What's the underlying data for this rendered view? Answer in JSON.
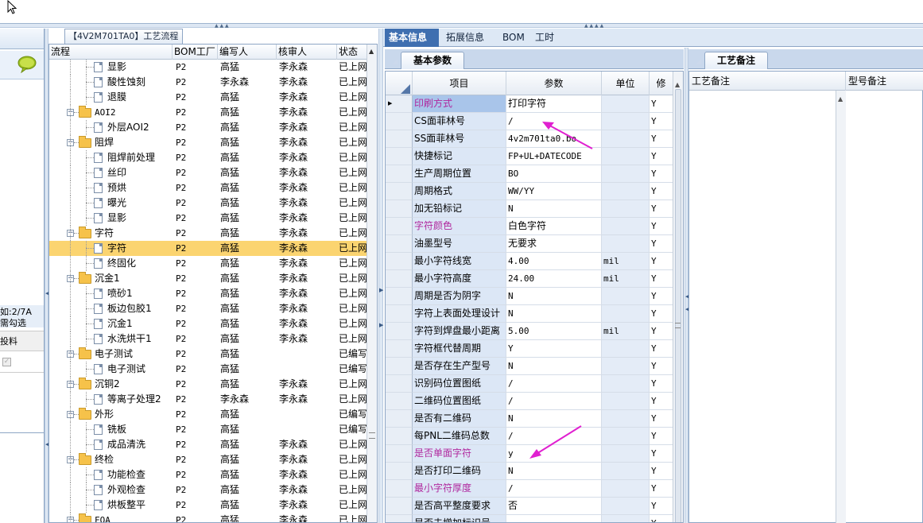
{
  "window": {
    "title": "【4V2M701TA0】工艺流程"
  },
  "left_panel": {
    "text1": "如:2/7A",
    "text2": "需勾选",
    "text3": "投料"
  },
  "tree": {
    "columns": [
      "流程",
      "BOM工厂",
      "编写人",
      "核审人",
      "状态"
    ],
    "rows": [
      {
        "level": 2,
        "kind": "doc",
        "name": "显影",
        "bom": "P2",
        "writer": "高猛",
        "checker": "李永森",
        "status": "已上网"
      },
      {
        "level": 2,
        "kind": "doc",
        "name": "酸性蚀刻",
        "bom": "P2",
        "writer": "李永森",
        "checker": "李永森",
        "status": "已上网"
      },
      {
        "level": 2,
        "kind": "doc",
        "name": "退膜",
        "bom": "P2",
        "writer": "高猛",
        "checker": "李永森",
        "status": "已上网"
      },
      {
        "level": 1,
        "kind": "folder",
        "name": "AOI2",
        "bom": "P2",
        "writer": "高猛",
        "checker": "李永森",
        "status": "已上网"
      },
      {
        "level": 2,
        "kind": "doc",
        "name": "外层AOI2",
        "bom": "P2",
        "writer": "高猛",
        "checker": "李永森",
        "status": "已上网"
      },
      {
        "level": 1,
        "kind": "folder",
        "name": "阻焊",
        "bom": "P2",
        "writer": "高猛",
        "checker": "李永森",
        "status": "已上网"
      },
      {
        "level": 2,
        "kind": "doc",
        "name": "阻焊前处理",
        "bom": "P2",
        "writer": "高猛",
        "checker": "李永森",
        "status": "已上网"
      },
      {
        "level": 2,
        "kind": "doc",
        "name": "丝印",
        "bom": "P2",
        "writer": "高猛",
        "checker": "李永森",
        "status": "已上网"
      },
      {
        "level": 2,
        "kind": "doc",
        "name": "预烘",
        "bom": "P2",
        "writer": "高猛",
        "checker": "李永森",
        "status": "已上网"
      },
      {
        "level": 2,
        "kind": "doc",
        "name": "曝光",
        "bom": "P2",
        "writer": "高猛",
        "checker": "李永森",
        "status": "已上网"
      },
      {
        "level": 2,
        "kind": "doc",
        "name": "显影",
        "bom": "P2",
        "writer": "高猛",
        "checker": "李永森",
        "status": "已上网"
      },
      {
        "level": 1,
        "kind": "folder",
        "name": "字符",
        "bom": "P2",
        "writer": "高猛",
        "checker": "李永森",
        "status": "已上网"
      },
      {
        "level": 2,
        "kind": "doc",
        "name": "字符",
        "bom": "P2",
        "writer": "高猛",
        "checker": "李永森",
        "status": "已上网",
        "selected": true
      },
      {
        "level": 2,
        "kind": "doc",
        "name": "终固化",
        "bom": "P2",
        "writer": "高猛",
        "checker": "李永森",
        "status": "已上网"
      },
      {
        "level": 1,
        "kind": "folder",
        "name": "沉金1",
        "bom": "P2",
        "writer": "高猛",
        "checker": "李永森",
        "status": "已上网"
      },
      {
        "level": 2,
        "kind": "doc",
        "name": "喷砂1",
        "bom": "P2",
        "writer": "高猛",
        "checker": "李永森",
        "status": "已上网"
      },
      {
        "level": 2,
        "kind": "doc",
        "name": "板边包胶1",
        "bom": "P2",
        "writer": "高猛",
        "checker": "李永森",
        "status": "已上网"
      },
      {
        "level": 2,
        "kind": "doc",
        "name": "沉金1",
        "bom": "P2",
        "writer": "高猛",
        "checker": "李永森",
        "status": "已上网"
      },
      {
        "level": 2,
        "kind": "doc",
        "name": "水洗烘干1",
        "bom": "P2",
        "writer": "高猛",
        "checker": "李永森",
        "status": "已上网"
      },
      {
        "level": 1,
        "kind": "folder",
        "name": "电子测试",
        "bom": "P2",
        "writer": "高猛",
        "checker": "",
        "status": "已编写"
      },
      {
        "level": 2,
        "kind": "doc",
        "name": "电子测试",
        "bom": "P2",
        "writer": "高猛",
        "checker": "",
        "status": "已编写"
      },
      {
        "level": 1,
        "kind": "folder",
        "name": "沉铜2",
        "bom": "P2",
        "writer": "高猛",
        "checker": "李永森",
        "status": "已上网"
      },
      {
        "level": 2,
        "kind": "doc",
        "name": "等离子处理2",
        "bom": "P2",
        "writer": "李永森",
        "checker": "李永森",
        "status": "已上网"
      },
      {
        "level": 1,
        "kind": "folder",
        "name": "外形",
        "bom": "P2",
        "writer": "高猛",
        "checker": "",
        "status": "已编写"
      },
      {
        "level": 2,
        "kind": "doc",
        "name": "铣板",
        "bom": "P2",
        "writer": "高猛",
        "checker": "",
        "status": "已编写"
      },
      {
        "level": 2,
        "kind": "doc",
        "name": "成品清洗",
        "bom": "P2",
        "writer": "高猛",
        "checker": "李永森",
        "status": "已上网"
      },
      {
        "level": 1,
        "kind": "folder",
        "name": "终检",
        "bom": "P2",
        "writer": "高猛",
        "checker": "李永森",
        "status": "已上网"
      },
      {
        "level": 2,
        "kind": "doc",
        "name": "功能检查",
        "bom": "P2",
        "writer": "高猛",
        "checker": "李永森",
        "status": "已上网"
      },
      {
        "level": 2,
        "kind": "doc",
        "name": "外观检查",
        "bom": "P2",
        "writer": "高猛",
        "checker": "李永森",
        "status": "已上网"
      },
      {
        "level": 2,
        "kind": "doc",
        "name": "烘板整平",
        "bom": "P2",
        "writer": "高猛",
        "checker": "李永森",
        "status": "已上网"
      },
      {
        "level": 1,
        "kind": "folder",
        "name": "FQA",
        "bom": "P2",
        "writer": "高猛",
        "checker": "李永森",
        "status": "已上网"
      }
    ]
  },
  "main_tabs": [
    {
      "label": "基本信息",
      "active": true
    },
    {
      "label": "拓展信息",
      "active": false
    },
    {
      "label": "BOM",
      "active": false
    },
    {
      "label": "工时",
      "active": false
    }
  ],
  "params_tab": {
    "label": "基本参数"
  },
  "params_grid": {
    "columns": [
      "项目",
      "参数",
      "单位",
      "修"
    ],
    "rows": [
      {
        "item": "印刷方式",
        "value": "打印字符",
        "unit": "",
        "flag": "Y",
        "highlight": true,
        "current": true
      },
      {
        "item": "CS面菲林号",
        "value": "/",
        "unit": "",
        "flag": "Y"
      },
      {
        "item": "SS面菲林号",
        "value": "4v2m701ta0.bo",
        "unit": "",
        "flag": "Y"
      },
      {
        "item": "快捷标记",
        "value": "FP+UL+DATECODE",
        "unit": "",
        "flag": "Y"
      },
      {
        "item": "生产周期位置",
        "value": "BO",
        "unit": "",
        "flag": "Y"
      },
      {
        "item": "周期格式",
        "value": "WW/YY",
        "unit": "",
        "flag": "Y"
      },
      {
        "item": "加无铅标记",
        "value": "N",
        "unit": "",
        "flag": "Y"
      },
      {
        "item": "字符颜色",
        "value": "白色字符",
        "unit": "",
        "flag": "Y",
        "highlight": true
      },
      {
        "item": "油墨型号",
        "value": "无要求",
        "unit": "",
        "flag": "Y"
      },
      {
        "item": "最小字符线宽",
        "value": "4.00",
        "unit": "mil",
        "flag": "Y"
      },
      {
        "item": "最小字符高度",
        "value": "24.00",
        "unit": "mil",
        "flag": "Y"
      },
      {
        "item": "周期是否为阴字",
        "value": "N",
        "unit": "",
        "flag": "Y"
      },
      {
        "item": "字符上表面处理设计",
        "value": "N",
        "unit": "",
        "flag": "Y"
      },
      {
        "item": "字符到焊盘最小距离",
        "value": "5.00",
        "unit": "mil",
        "flag": "Y"
      },
      {
        "item": "字符框代替周期",
        "value": "Y",
        "unit": "",
        "flag": "Y"
      },
      {
        "item": "是否存在生产型号",
        "value": "N",
        "unit": "",
        "flag": "Y"
      },
      {
        "item": "识别码位置图纸",
        "value": "/",
        "unit": "",
        "flag": "Y"
      },
      {
        "item": "二维码位置图纸",
        "value": "/",
        "unit": "",
        "flag": "Y"
      },
      {
        "item": "是否有二维码",
        "value": "N",
        "unit": "",
        "flag": "Y"
      },
      {
        "item": "每PNL二维码总数",
        "value": "/",
        "unit": "",
        "flag": "Y"
      },
      {
        "item": "是否单面字符",
        "value": "y",
        "unit": "",
        "flag": "Y",
        "highlight": true
      },
      {
        "item": "是否打印二维码",
        "value": "N",
        "unit": "",
        "flag": "Y"
      },
      {
        "item": "最小字符厚度",
        "value": "/",
        "unit": "",
        "flag": "Y",
        "highlight": true
      },
      {
        "item": "是否高平整度要求",
        "value": "否",
        "unit": "",
        "flag": "Y"
      },
      {
        "item": "是否去增加标识号",
        "value": "",
        "unit": "",
        "flag": "Y"
      }
    ]
  },
  "notes_tab": {
    "label": "工艺备注"
  },
  "notes": {
    "columns": [
      "工艺备注",
      "型号备注"
    ]
  },
  "colors": {
    "accent": "#3f6fb0",
    "selected_row": "#fbd470",
    "highlight_text": "#b0289e",
    "annotation_arrow": "#e020d0"
  }
}
